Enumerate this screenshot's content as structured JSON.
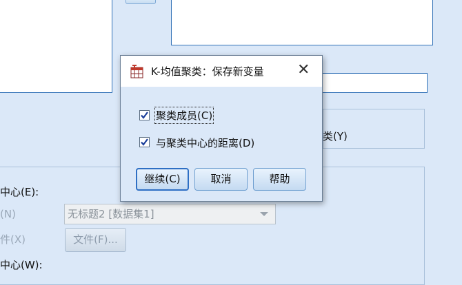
{
  "background": {
    "y_label": "类(Y)",
    "centers_label": "中心(E):",
    "dataset_label_fragment": "(N)",
    "dataset_combo_value": "无标题2 [数据集1]",
    "file_label_fragment": "件(X)",
    "file_button_label": "文件(F)...",
    "centers_w_label": "中心(W):"
  },
  "dialog": {
    "title": "K-均值聚类：保存新变量",
    "close_glyph": "✕",
    "options": [
      {
        "label": "聚类成员(C)",
        "checked": true
      },
      {
        "label": "与聚类中心的距离(D)",
        "checked": true
      }
    ],
    "buttons": {
      "continue": "继续(C)",
      "cancel": "取消",
      "help": "帮助"
    }
  }
}
